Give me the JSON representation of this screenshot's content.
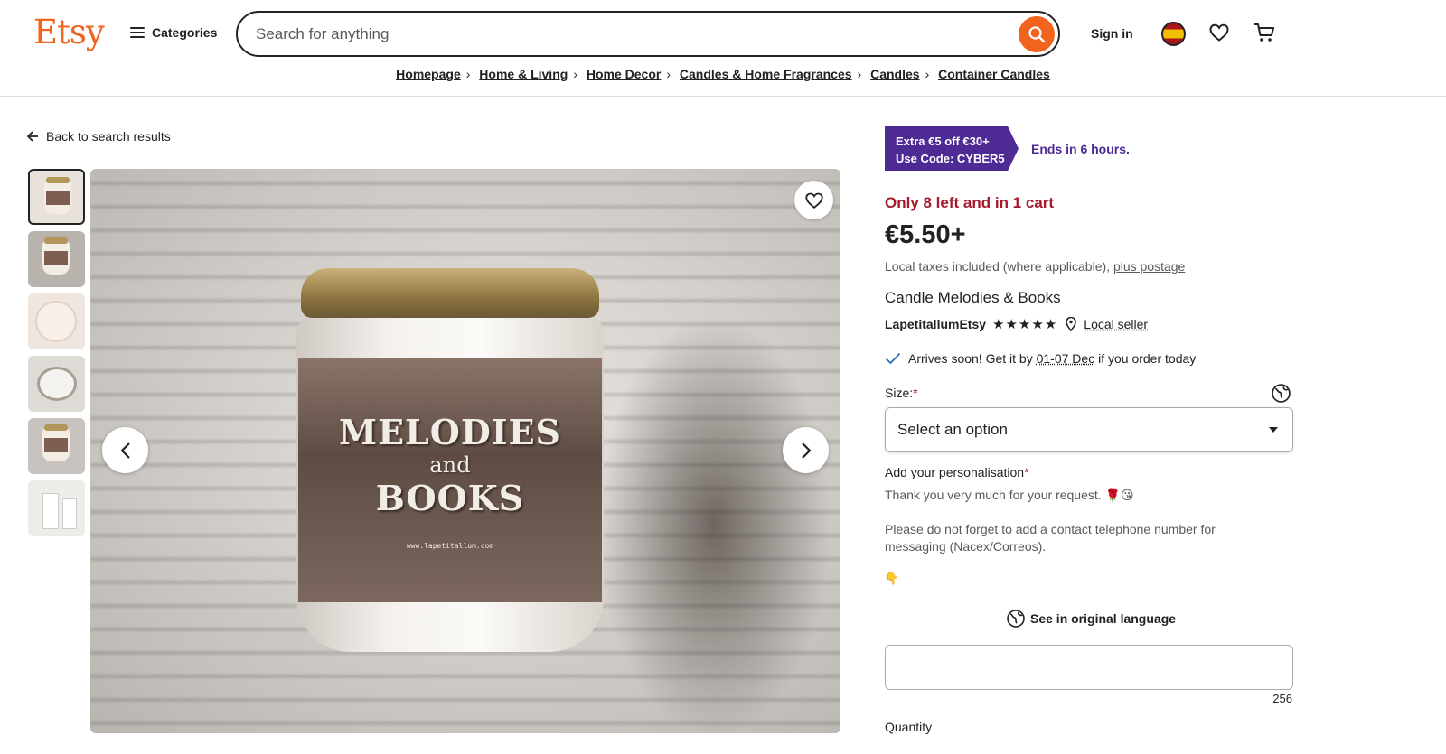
{
  "header": {
    "logo": "Etsy",
    "categories_label": "Categories",
    "search_placeholder": "Search for anything",
    "signin_label": "Sign in",
    "brand_color": "#f1641e"
  },
  "breadcrumb": [
    "Homepage",
    "Home & Living",
    "Home Decor",
    "Candles & Home Fragrances",
    "Candles",
    "Container Candles"
  ],
  "gallery": {
    "back_label": "Back to search results",
    "thumbnail_count": 6,
    "selected_thumbnail": 1,
    "label_line1": "MELODIES",
    "label_line2": "and",
    "label_line3": "BOOKS",
    "label_url": "www.lapetitallum.com"
  },
  "listing": {
    "promo_line1": "Extra €5 off €30+",
    "promo_line2": "Use Code: CYBER5",
    "promo_ends": "Ends in 6 hours.",
    "stock_note": "Only 8 left and in 1 cart",
    "price": "€5.50+",
    "taxes_text": "Local taxes included (where applicable),",
    "postage_link": "plus postage",
    "title": "Candle Melodies & Books",
    "seller_name": "LapetitallumEtsy",
    "rating_stars": "★★★★★",
    "local_seller": "Local seller",
    "arrives_prefix": "Arrives soon! Get it by",
    "arrives_dates": "01-07 Dec",
    "arrives_suffix": "if you order today",
    "size_label": "Size:",
    "required_mark": "*",
    "size_select_value": "Select an option",
    "personalisation_label": "Add your personalisation",
    "personalisation_line1": "Thank you very much for your request. 🌹😘",
    "personalisation_line2": "Please do not forget to add a contact telephone number for messaging (Nacex/Correos).",
    "personalisation_line3": "👇",
    "see_original": "See in original language",
    "char_counter": "256",
    "quantity_label": "Quantity",
    "promo_color": "#4d2a94",
    "stock_color": "#a61a2e"
  }
}
